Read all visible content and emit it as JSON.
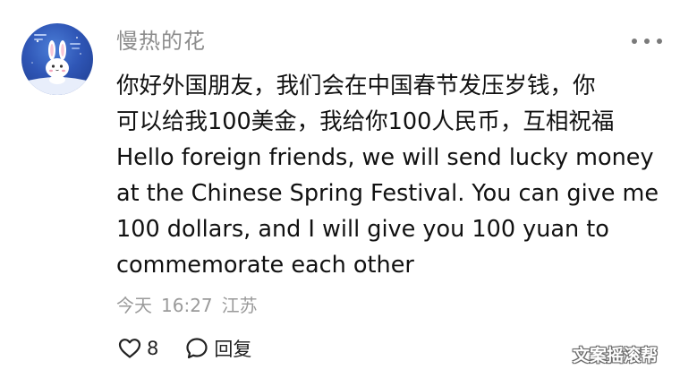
{
  "comment": {
    "username": "慢热的花",
    "avatar_icon": "bunny-avatar-icon",
    "body_lines": [
      "你好外国朋友，我们会在中国春节发压岁钱，你",
      "可以给我100美金，我给你100人民币，互相祝福",
      "Hello foreign friends, we will send lucky money",
      "at the Chinese Spring Festival. You can give me",
      "100 dollars, and I will give you 100 yuan to",
      "commemorate each other"
    ],
    "meta": {
      "date": "今天",
      "time": "16:27",
      "location": "江苏"
    },
    "actions": {
      "like_icon": "heart-icon",
      "like_count": "8",
      "reply_icon": "speech-bubble-icon",
      "reply_label": "回复"
    },
    "more_icon": "more-dots-icon"
  },
  "watermark": "文案摇滚帮",
  "colors": {
    "username": "#8d8d8d",
    "body_text": "#111111",
    "meta_text": "#9a9a9a",
    "background": "#ffffff"
  }
}
